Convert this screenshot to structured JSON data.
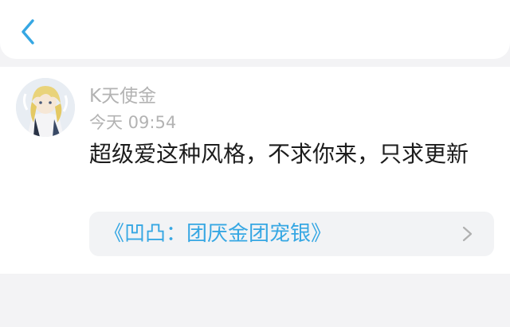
{
  "header": {
    "back_icon": "chevron-left-icon",
    "accent_color": "#36a7e3"
  },
  "comment": {
    "username": "K天使金",
    "timestamp": "今天 09:54",
    "text": "超级爱这种风格，不求你来，只求更新",
    "avatar_icon": "avatar"
  },
  "linked_work": {
    "title": "《凹凸：团厌金团宠银》",
    "chevron_icon": "chevron-right-icon"
  }
}
